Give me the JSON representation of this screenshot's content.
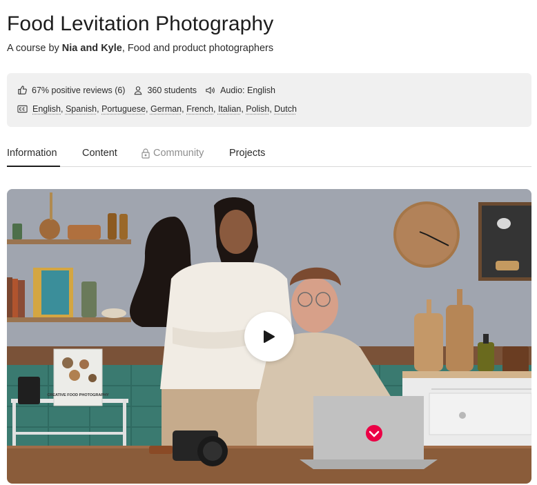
{
  "course": {
    "title": "Food Levitation Photography",
    "subtitle_prefix": "A course by ",
    "authors": "Nia and Kyle",
    "subtitle_suffix": ", Food and product photographers"
  },
  "stats": {
    "reviews": "67% positive reviews (6)",
    "students": "360 students",
    "audio": "Audio: English",
    "subtitles": [
      "English",
      "Spanish",
      "Portuguese",
      "German",
      "French",
      "Italian",
      "Polish",
      "Dutch"
    ]
  },
  "tabs": [
    {
      "label": "Information",
      "active": true
    },
    {
      "label": "Content",
      "active": false
    },
    {
      "label": "Community",
      "active": false,
      "locked": true
    },
    {
      "label": "Projects",
      "active": false
    }
  ],
  "video": {
    "book_title": "CREATIVE FOOD PHOTOGRAPHY"
  },
  "colors": {
    "accent": "#eb0045",
    "info_bg": "#f0f0f0"
  }
}
